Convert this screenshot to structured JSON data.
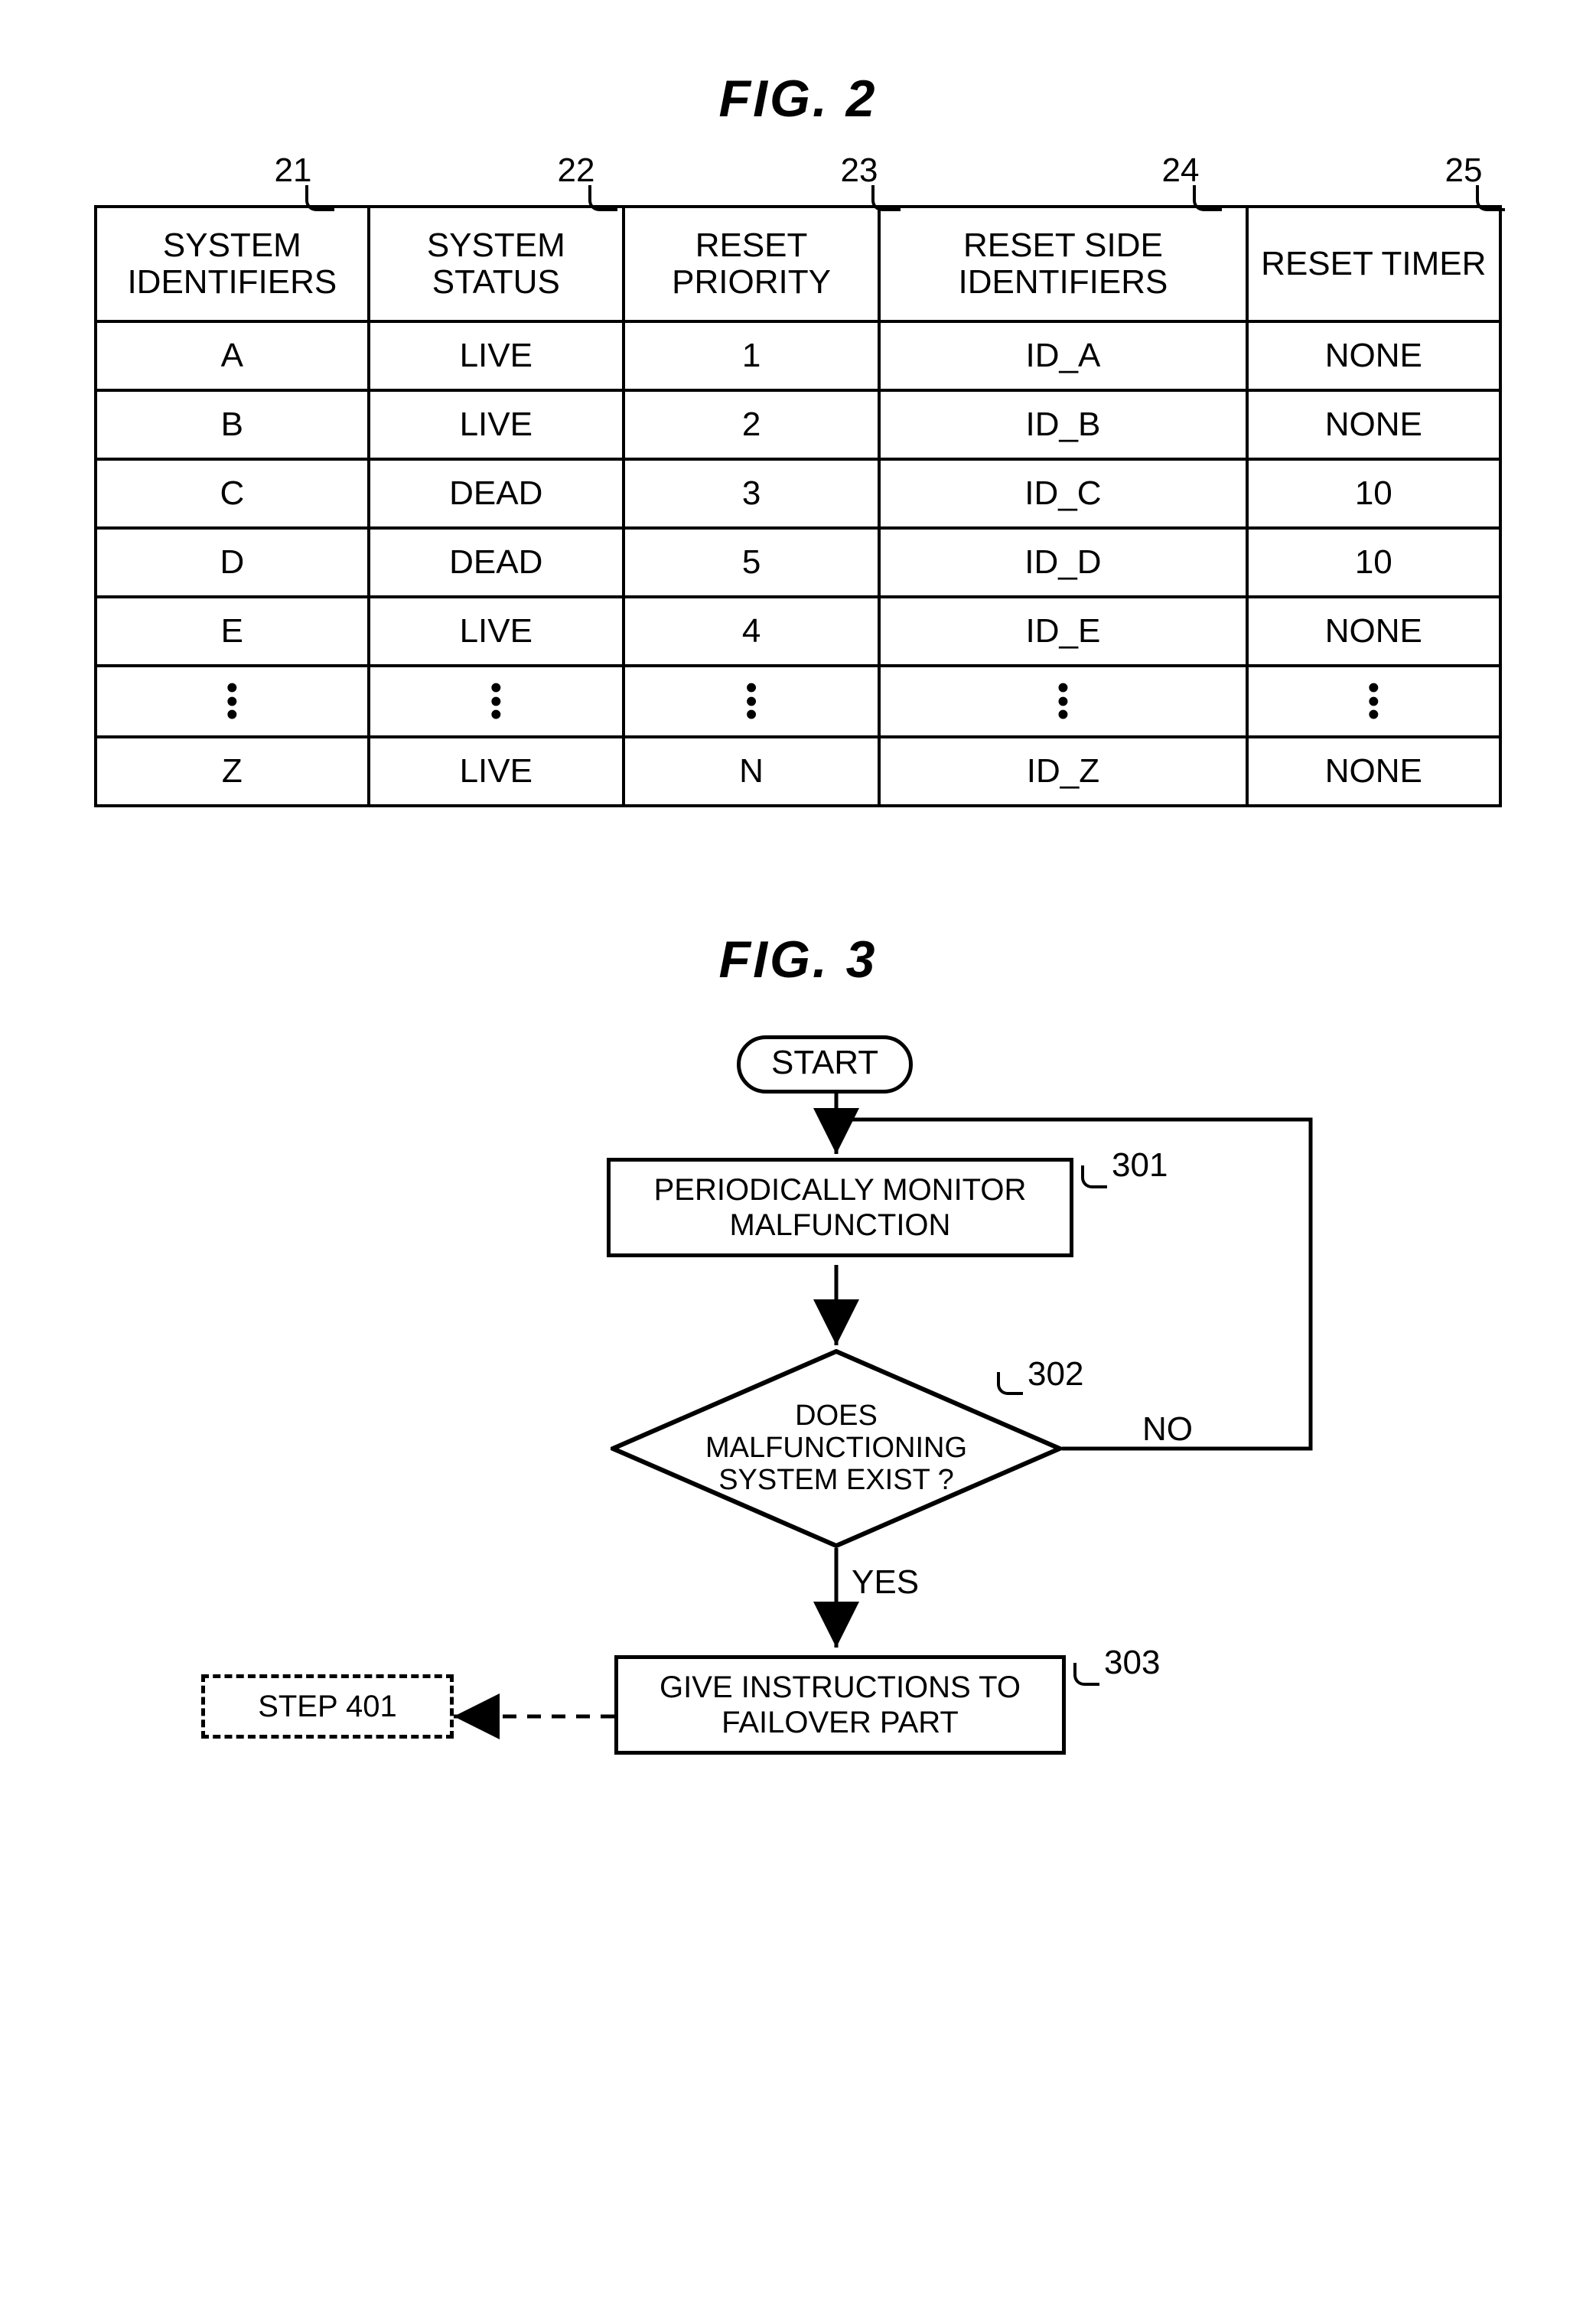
{
  "fig2": {
    "title": "FIG. 2",
    "column_refs": [
      "21",
      "22",
      "23",
      "24",
      "25"
    ],
    "headers": [
      "SYSTEM IDENTIFIERS",
      "SYSTEM STATUS",
      "RESET PRIORITY",
      "RESET SIDE IDENTIFIERS",
      "RESET TIMER"
    ],
    "rows": [
      [
        "A",
        "LIVE",
        "1",
        "ID_A",
        "NONE"
      ],
      [
        "B",
        "LIVE",
        "2",
        "ID_B",
        "NONE"
      ],
      [
        "C",
        "DEAD",
        "3",
        "ID_C",
        "10"
      ],
      [
        "D",
        "DEAD",
        "5",
        "ID_D",
        "10"
      ],
      [
        "E",
        "LIVE",
        "4",
        "ID_E",
        "NONE"
      ],
      [
        "⋮",
        "⋮",
        "⋮",
        "⋮",
        "⋮"
      ],
      [
        "Z",
        "LIVE",
        "N",
        "ID_Z",
        "NONE"
      ]
    ]
  },
  "fig3": {
    "title": "FIG. 3",
    "start": "START",
    "step301": {
      "ref": "301",
      "text": "PERIODICALLY MONITOR MALFUNCTION"
    },
    "step302": {
      "ref": "302",
      "text": "DOES MALFUNCTIONING SYSTEM EXIST ?",
      "yes": "YES",
      "no": "NO"
    },
    "step303": {
      "ref": "303",
      "text": "GIVE INSTRUCTIONS TO FAILOVER PART"
    },
    "step401": "STEP 401"
  }
}
